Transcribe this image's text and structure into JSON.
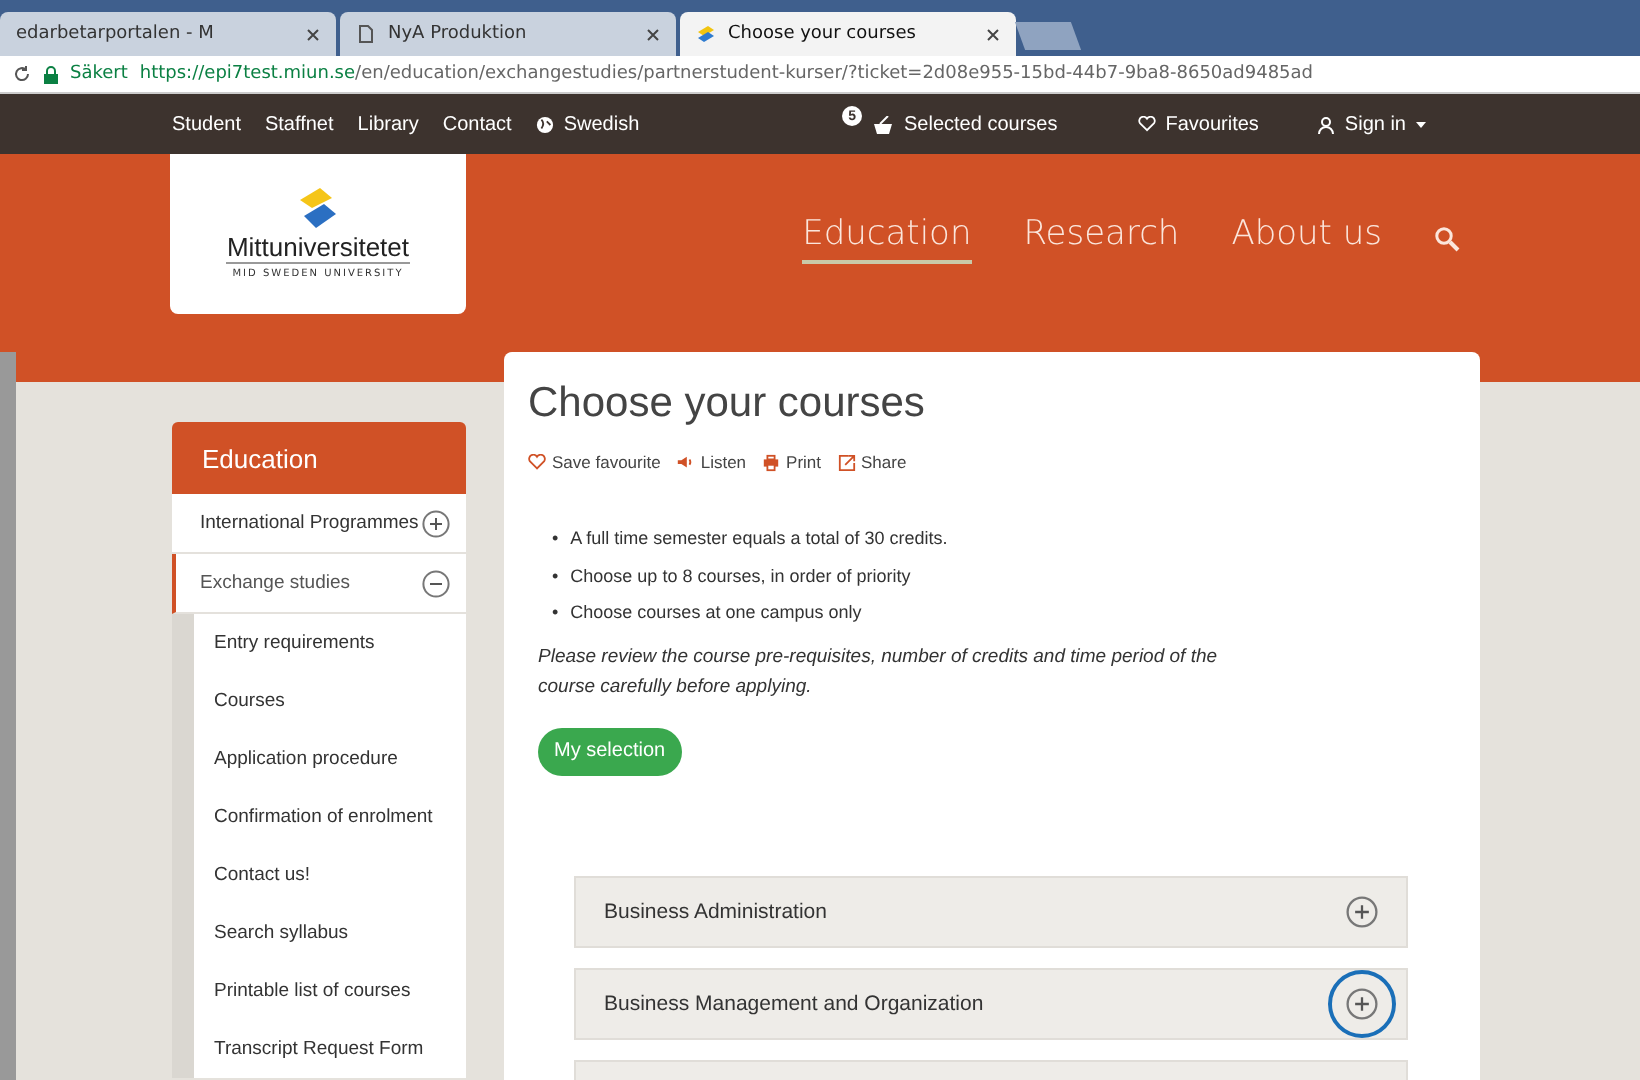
{
  "browser": {
    "tabs": [
      {
        "title": "edarbetarportalen - M",
        "selected": false
      },
      {
        "title": "NyA Produktion",
        "selected": false
      },
      {
        "title": "Choose your courses",
        "selected": true
      }
    ],
    "address": {
      "secure_label": "Säkert",
      "url_host": "https://epi7test.miun.se",
      "url_path": "/en/education/exchangestudies/partnerstudent-kurser/?ticket=2d08e955-15bd-44b7-9ba8-8650ad9485ad"
    }
  },
  "top_nav": {
    "links": [
      "Student",
      "Staffnet",
      "Library",
      "Contact"
    ],
    "language": "Swedish",
    "cart_count": "5",
    "selected_courses": "Selected courses",
    "favourites": "Favourites",
    "sign_in": "Sign in"
  },
  "logo": {
    "name": "Mittuniversitetet",
    "subtitle": "MID SWEDEN UNIVERSITY"
  },
  "main_menu": [
    {
      "label": "Education",
      "selected": true
    },
    {
      "label": "Research",
      "selected": false
    },
    {
      "label": "About us",
      "selected": false
    }
  ],
  "sidebar": {
    "title": "Education",
    "items": [
      {
        "label": "International Programmes",
        "expanded": false
      },
      {
        "label": "Exchange studies",
        "expanded": true,
        "children": [
          {
            "label": "Entry requirements"
          },
          {
            "label": "Courses"
          },
          {
            "label": "Application procedure"
          },
          {
            "label": "Confirmation of enrolment"
          },
          {
            "label": "Contact us!"
          },
          {
            "label": "Search syllabus"
          },
          {
            "label": "Printable list of courses"
          },
          {
            "label": "Transcript Request Form"
          }
        ]
      }
    ]
  },
  "page": {
    "title": "Choose your courses",
    "actions": [
      "Save favourite",
      "Listen",
      "Print",
      "Share"
    ],
    "bullet_marker": "•",
    "bullets": [
      "A full time semester equals a total of 30 credits.",
      "Choose up to 8 courses, in order of priority",
      "Choose courses at one campus only"
    ],
    "note": "Please review the course pre-requisites, number of credits and time period of the course carefully before applying.",
    "selection_button": "My selection",
    "subjects": [
      {
        "label": "Business Administration",
        "highlighted": false
      },
      {
        "label": "Business Management and Organization",
        "highlighted": true
      },
      {
        "highlighted": false
      }
    ]
  }
}
